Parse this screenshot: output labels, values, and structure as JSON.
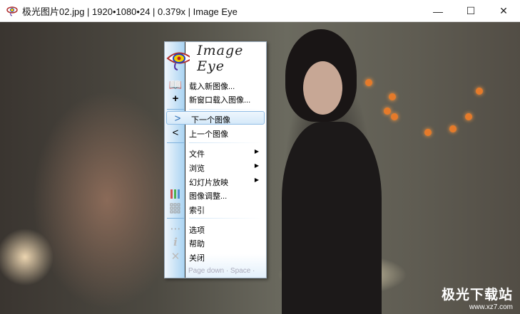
{
  "window": {
    "title": "极光图片02.jpg | 1920•1080•24 | 0.379x | Image Eye",
    "minimize": "—",
    "maximize": "☐",
    "close": "✕"
  },
  "menu": {
    "logo_text": "Image Eye",
    "items": [
      {
        "label": "载入新图像...",
        "icon": "open-book-icon"
      },
      {
        "label": "新窗口载入图像...",
        "icon": "plus-icon"
      },
      {
        "label": "下一个图像",
        "icon": "chevron-right-icon",
        "highlighted": true
      },
      {
        "label": "上一个图像",
        "icon": "chevron-left-icon"
      },
      {
        "label": "文件",
        "submenu": true
      },
      {
        "label": "浏览",
        "submenu": true
      },
      {
        "label": "幻灯片放映",
        "submenu": true
      },
      {
        "label": "图像调整...",
        "icon": "color-bars-icon"
      },
      {
        "label": "索引",
        "icon": "grid-icon"
      },
      {
        "label": "选项",
        "icon": "dots-icon"
      },
      {
        "label": "帮助",
        "icon": "info-icon"
      },
      {
        "label": "关闭",
        "icon": "close-icon"
      }
    ],
    "hint": "Page down · Space ·"
  },
  "watermark": {
    "title": "极光下载站",
    "url": "www.xz7.com"
  }
}
